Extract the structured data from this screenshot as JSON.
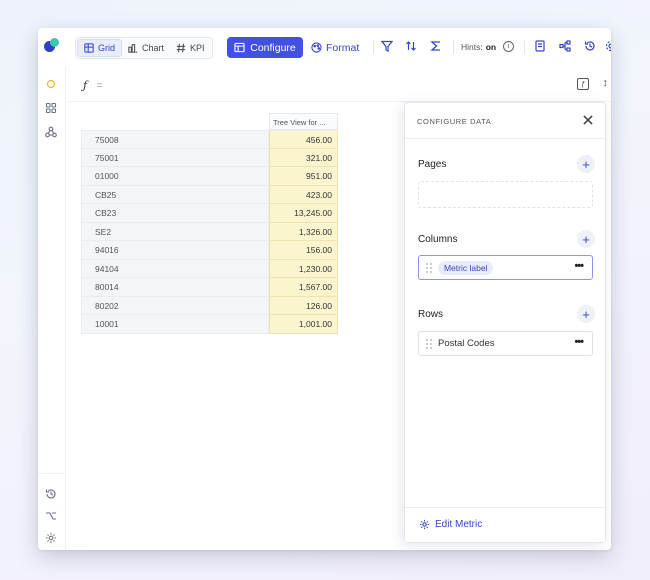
{
  "toolbar": {
    "view_tabs": [
      {
        "label": "Grid",
        "icon": "grid-icon",
        "active": true
      },
      {
        "label": "Chart",
        "icon": "chart-icon",
        "active": false
      },
      {
        "label": "KPI",
        "icon": "hash-icon",
        "active": false
      }
    ],
    "configure_label": "Configure",
    "format_label": "Format",
    "hints_label": "Hints:",
    "hints_value": "on",
    "info_glyph": "i",
    "accent_color": "#4350e6"
  },
  "formula_bar": {
    "fx_glyph": "ƒ",
    "equals": "=",
    "fx_button_glyph": "ƒ",
    "resize_glyph": "↕"
  },
  "grid": {
    "column_header": "Tree View for ...",
    "rows": [
      {
        "key": "75008",
        "value": "456.00"
      },
      {
        "key": "75001",
        "value": "321.00"
      },
      {
        "key": "01000",
        "value": "951.00"
      },
      {
        "key": "CB25",
        "value": "423.00"
      },
      {
        "key": "CB23",
        "value": "13,245.00"
      },
      {
        "key": "SE2",
        "value": "1,326.00"
      },
      {
        "key": "94016",
        "value": "156.00"
      },
      {
        "key": "94104",
        "value": "1,230.00"
      },
      {
        "key": "80014",
        "value": "1,567.00"
      },
      {
        "key": "80202",
        "value": "126.00"
      },
      {
        "key": "10001",
        "value": "1,001.00"
      }
    ]
  },
  "panel": {
    "title": "CONFIGURE DATA",
    "add_glyph": "+",
    "more_glyph": "•••",
    "pages_label": "Pages",
    "columns_label": "Columns",
    "columns_items": [
      "Metric label"
    ],
    "rows_label": "Rows",
    "rows_items": [
      "Postal Codes"
    ],
    "footer_label": "Edit Metric"
  }
}
